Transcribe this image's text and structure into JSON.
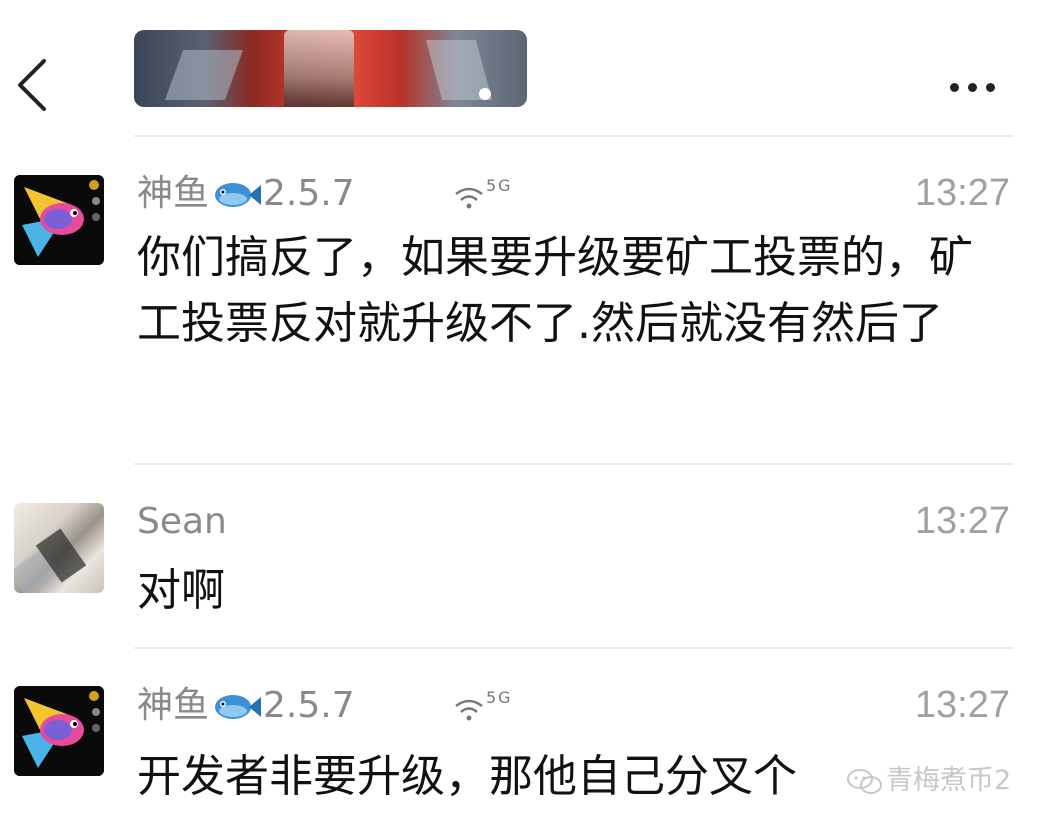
{
  "header": {
    "back_icon": "chevron-left-icon",
    "more_icon": "more-dots-icon"
  },
  "messages": [
    {
      "sender": "神鱼",
      "badge_icon": "fish-emoji",
      "version": "2.5.7",
      "network": "5G",
      "time": "13:27",
      "text": "你们搞反了，如果要升级要矿工投票的，矿工投票反对就升级不了.然后就没有然后了"
    },
    {
      "sender": "Sean",
      "time": "13:27",
      "text": "对啊"
    },
    {
      "sender": "神鱼",
      "badge_icon": "fish-emoji",
      "version": "2.5.7",
      "network": "5G",
      "time": "13:27",
      "text": "开发者非要升级，那他自己分叉个"
    }
  ],
  "watermark": {
    "text": "青梅煮币2",
    "icon": "wechat-icon"
  }
}
